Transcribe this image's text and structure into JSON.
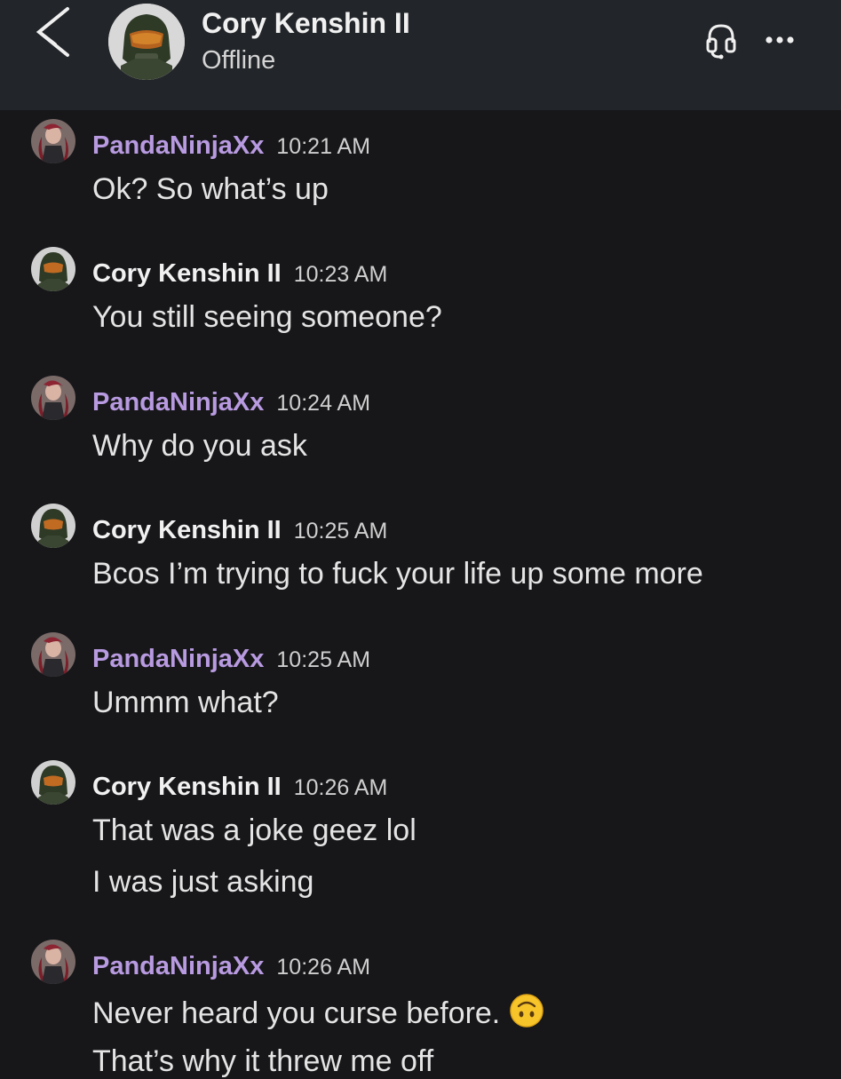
{
  "header": {
    "name": "Cory Kenshin II",
    "status": "Offline"
  },
  "messages": [
    {
      "author": "PandaNinjaXx",
      "time": "10:21 AM",
      "lines": [
        "Ok? So what’s up"
      ]
    },
    {
      "author": "Cory Kenshin II",
      "time": "10:23 AM",
      "lines": [
        "You still seeing someone?"
      ]
    },
    {
      "author": "PandaNinjaXx",
      "time": "10:24 AM",
      "lines": [
        "Why do you ask"
      ]
    },
    {
      "author": "Cory Kenshin II",
      "time": "10:25 AM",
      "lines": [
        "Bcos I’m trying to fuck your life up some more"
      ]
    },
    {
      "author": "PandaNinjaXx",
      "time": "10:25 AM",
      "lines": [
        "Ummm what?"
      ]
    },
    {
      "author": "Cory Kenshin II",
      "time": "10:26 AM",
      "lines": [
        "That was a joke geez lol",
        "I was just asking"
      ]
    },
    {
      "author": "PandaNinjaXx",
      "time": "10:26 AM",
      "lines": [
        "Never heard you curse before.",
        "That’s why it threw me off"
      ],
      "emoji": "upside-down-face"
    }
  ],
  "colors": {
    "background": "#17171a",
    "header": "#222529",
    "panda_name": "#b89ae0",
    "cory_name": "#f1f1f1"
  }
}
